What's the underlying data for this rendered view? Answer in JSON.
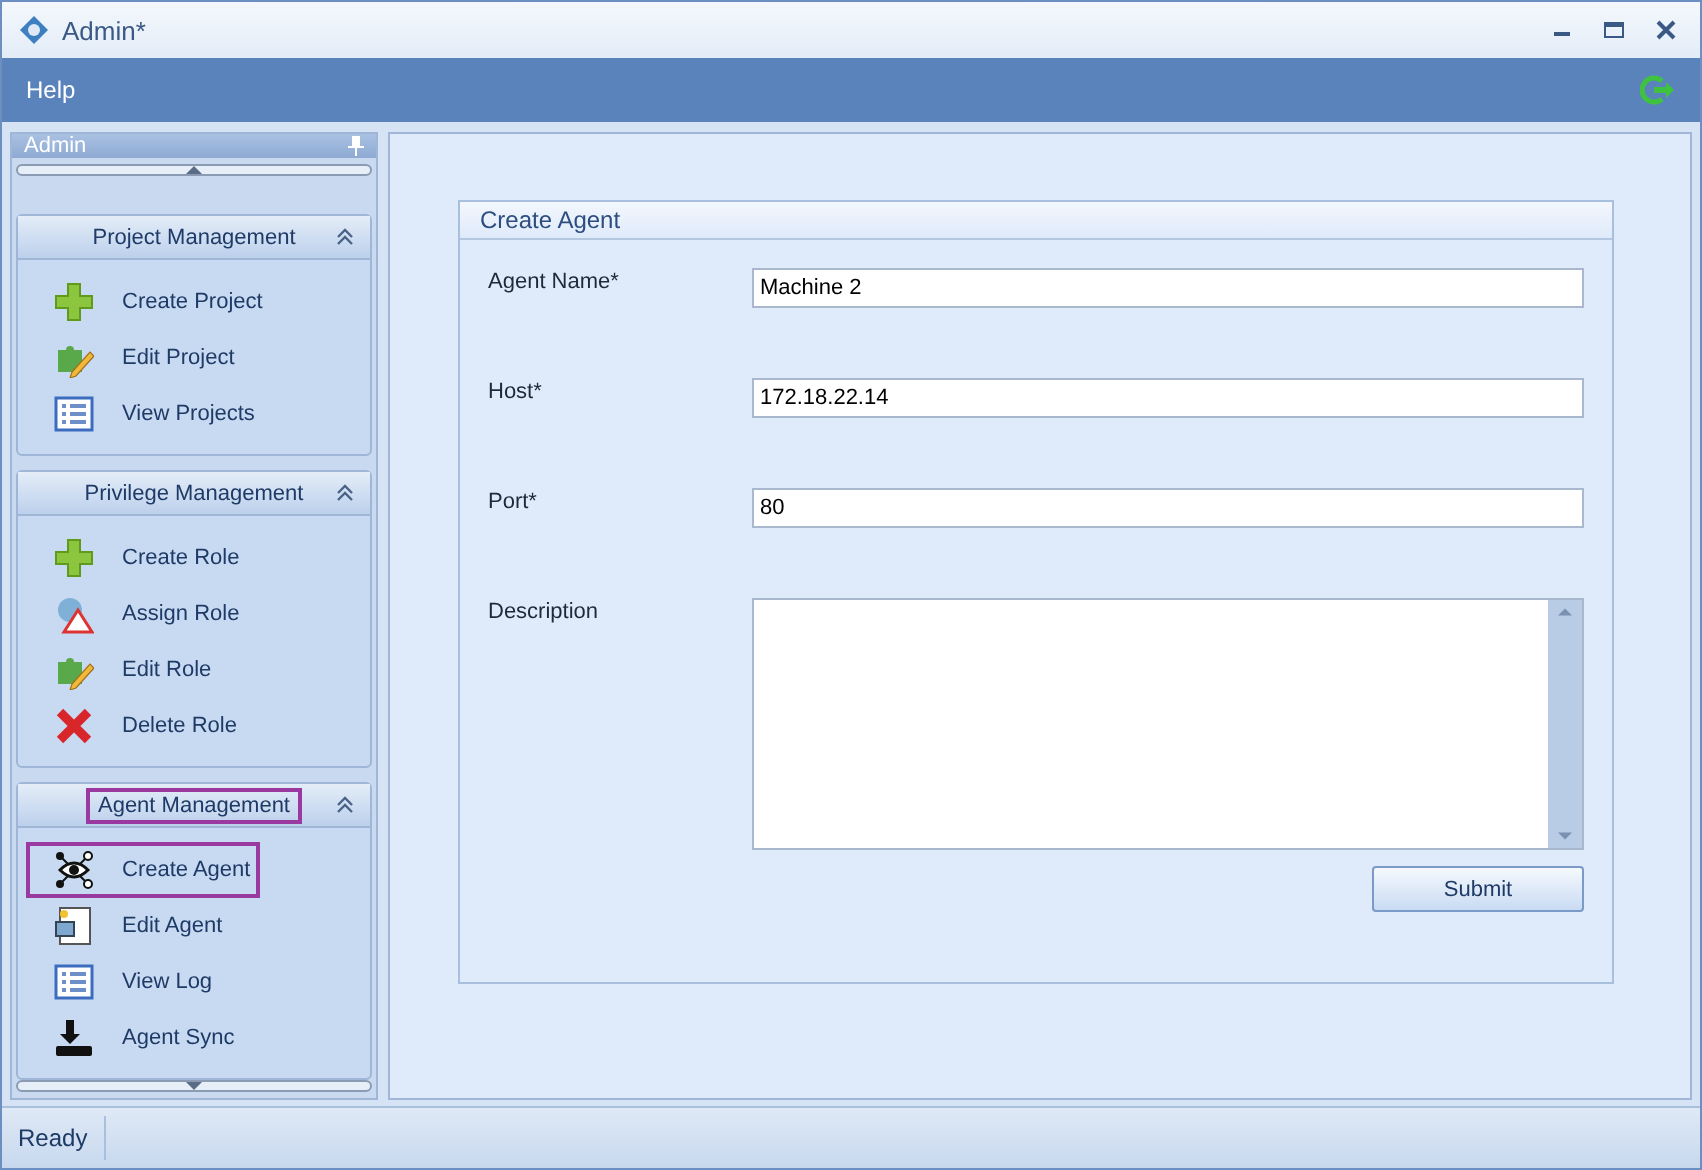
{
  "window": {
    "title": "Admin*"
  },
  "menu": {
    "items": [
      "Help"
    ]
  },
  "sidebar": {
    "title": "Admin",
    "groups": [
      {
        "title": "Project Management",
        "expanded": true,
        "highlighted": false,
        "items": [
          {
            "kind": "add",
            "label": "Create Project",
            "highlighted": false
          },
          {
            "kind": "edit",
            "label": "Edit Project",
            "highlighted": false
          },
          {
            "kind": "list",
            "label": "View Projects",
            "highlighted": false
          }
        ]
      },
      {
        "title": "Privilege Management",
        "expanded": true,
        "highlighted": false,
        "items": [
          {
            "kind": "add",
            "label": "Create Role",
            "highlighted": false
          },
          {
            "kind": "assign",
            "label": "Assign Role",
            "highlighted": false
          },
          {
            "kind": "edit",
            "label": "Edit Role",
            "highlighted": false
          },
          {
            "kind": "delete",
            "label": "Delete Role",
            "highlighted": false
          }
        ]
      },
      {
        "title": "Agent Management",
        "expanded": true,
        "highlighted": true,
        "items": [
          {
            "kind": "network",
            "label": "Create Agent",
            "highlighted": true
          },
          {
            "kind": "agent",
            "label": "Edit Agent",
            "highlighted": false
          },
          {
            "kind": "list",
            "label": "View Log",
            "highlighted": false
          },
          {
            "kind": "download",
            "label": "Agent Sync",
            "highlighted": false
          }
        ]
      }
    ]
  },
  "form": {
    "title": "Create Agent",
    "fields": [
      {
        "kind": "text",
        "label": "Agent Name*",
        "value": "Machine 2"
      },
      {
        "kind": "text",
        "label": "Host*",
        "value": "172.18.22.14"
      },
      {
        "kind": "text",
        "label": "Port*",
        "value": "80"
      },
      {
        "kind": "textarea",
        "label": "Description"
      }
    ],
    "submit": "Submit"
  },
  "status_bar": {
    "text": "Ready"
  }
}
